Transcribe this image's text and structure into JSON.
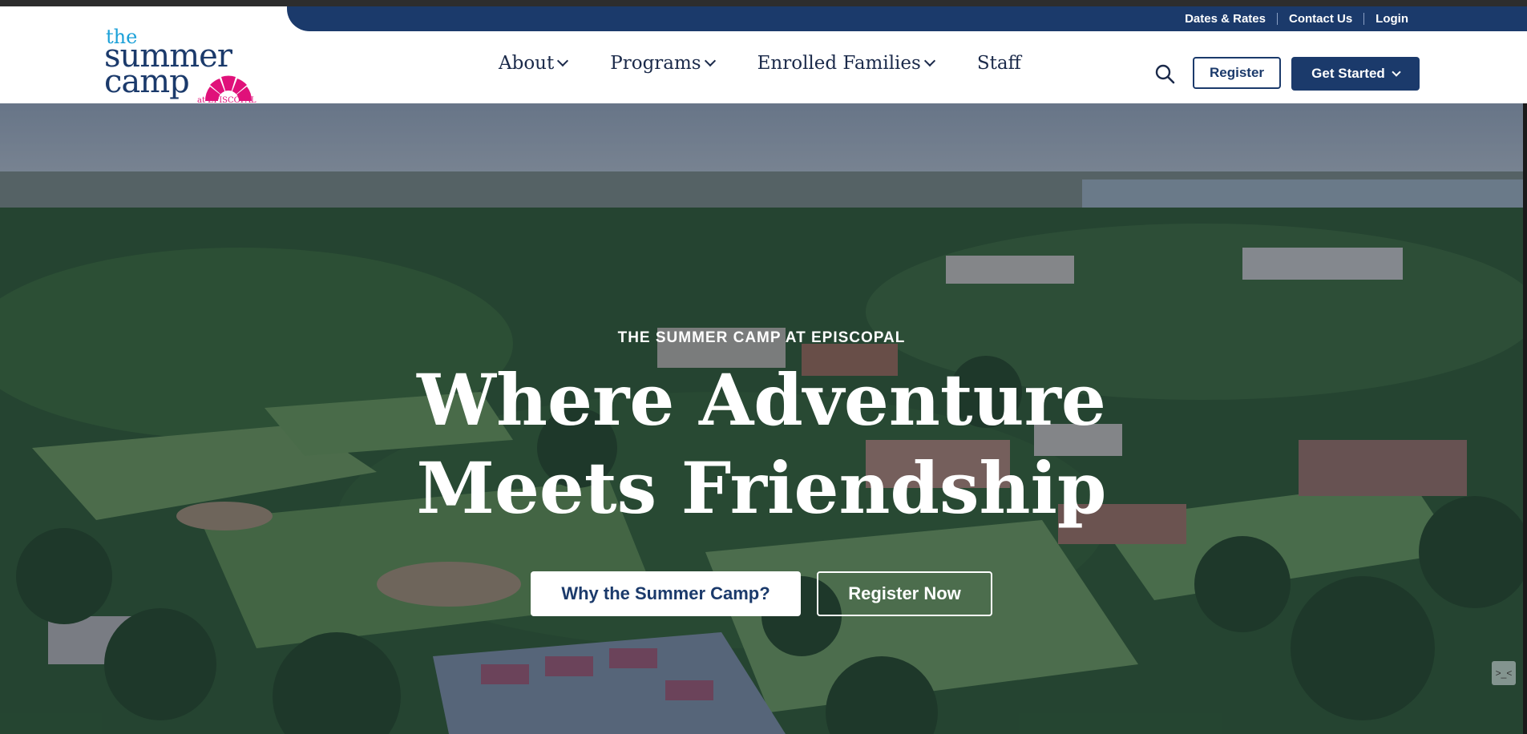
{
  "utility_nav": {
    "items": [
      "Dates & Rates",
      "Contact Us",
      "Login"
    ]
  },
  "logo": {
    "line1": "the",
    "line2": "summer",
    "line3": "camp",
    "line4": "at EPISCOPAL"
  },
  "main_nav": {
    "items": [
      {
        "label": "About"
      },
      {
        "label": "Programs"
      },
      {
        "label": "Enrolled Families"
      },
      {
        "label": "Staff"
      }
    ]
  },
  "header_actions": {
    "register_label": "Register",
    "get_started_label": "Get Started"
  },
  "hero": {
    "eyebrow": "THE SUMMER CAMP AT EPISCOPAL",
    "headline_line1": "Where Adventure",
    "headline_line2": "Meets Friendship",
    "cta_primary": "Why the Summer Camp?",
    "cta_secondary": "Register Now"
  },
  "colors": {
    "brand_navy": "#1b3a6b",
    "brand_pink": "#e0117a",
    "brand_blue": "#1aa0d8"
  },
  "icons": {
    "search": "search-icon",
    "chevron": "chevron-down-icon"
  }
}
